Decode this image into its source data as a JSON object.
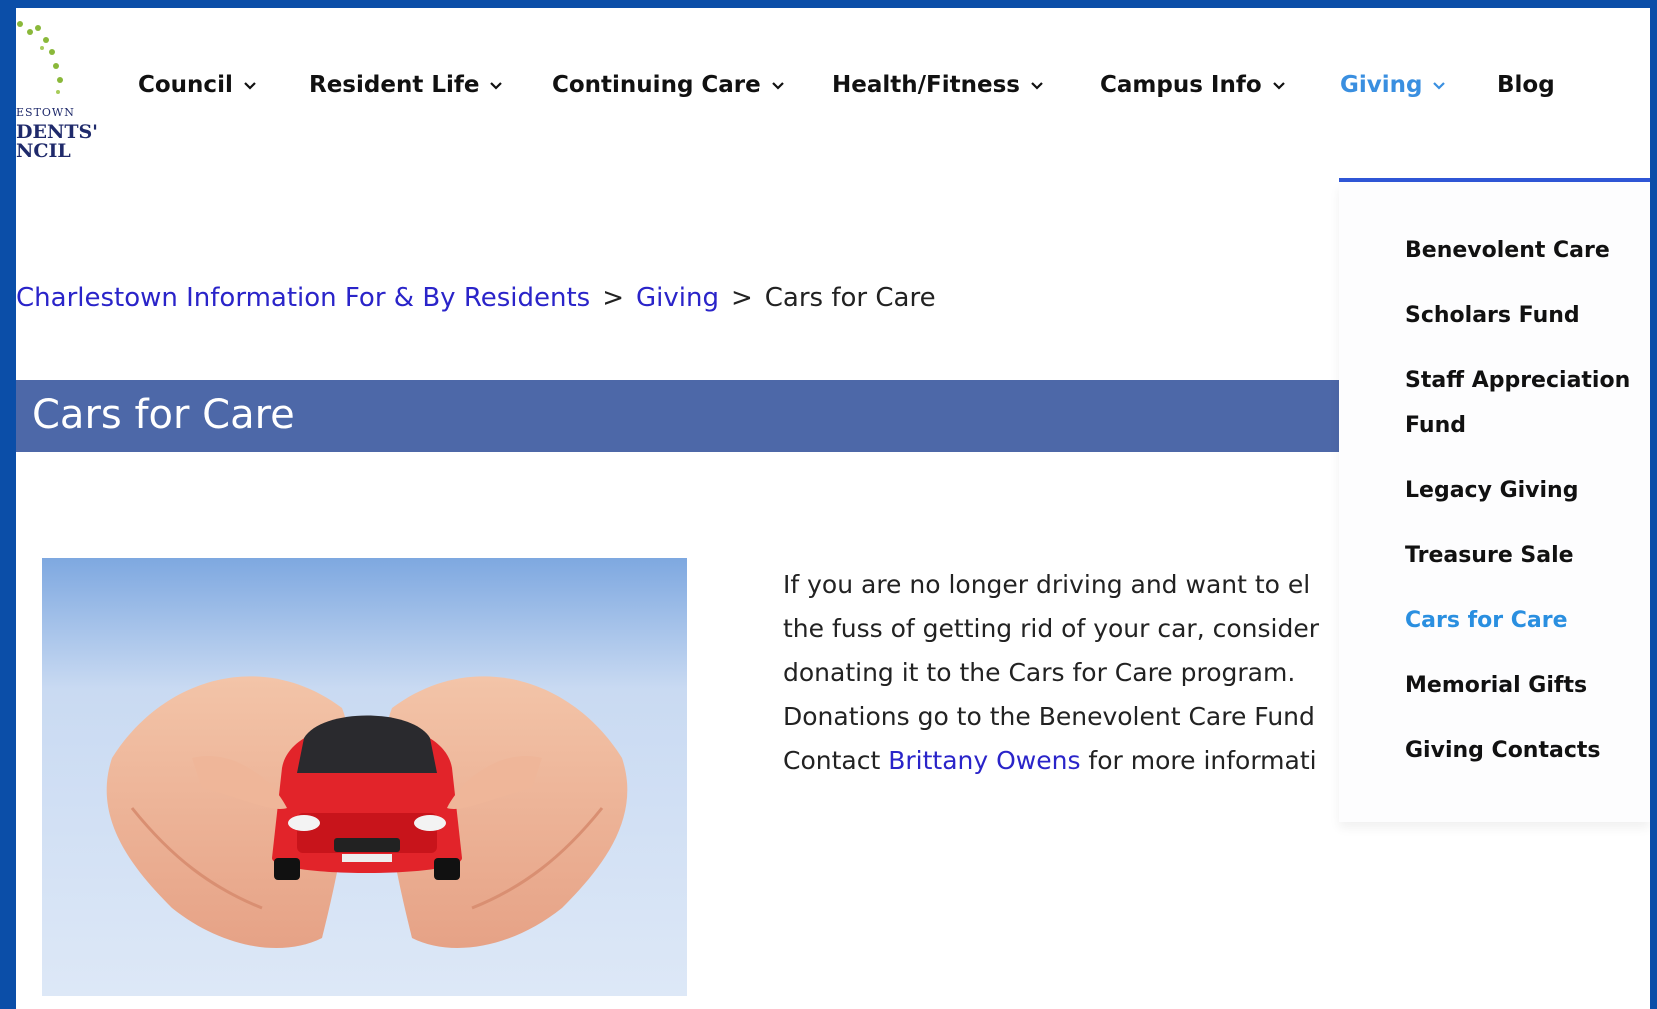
{
  "logo": {
    "line1": "ESTOWN",
    "line2": "DENTS'",
    "line3": "NCIL"
  },
  "nav": {
    "items": [
      {
        "label": "Council"
      },
      {
        "label": "Resident Life"
      },
      {
        "label": "Continuing Care"
      },
      {
        "label": "Health/Fitness"
      },
      {
        "label": "Campus Info"
      },
      {
        "label": "Giving"
      },
      {
        "label": "Blog"
      }
    ],
    "active": "Giving",
    "accent_color": "#3a8fe0"
  },
  "breadcrumb": {
    "home": "Charlestown Information For & By Residents",
    "sep": ">",
    "section": "Giving",
    "current": "Cars for Care"
  },
  "page": {
    "title": "Cars for Care",
    "title_bar_color": "#4d68a8"
  },
  "content": {
    "lines": [
      "If you are no longer driving and want to el",
      "the fuss of getting rid of your car, consider",
      "donating it to the Cars for Care program.",
      "Donations go to the Benevolent Care Fund"
    ],
    "contact_prefix": "Contact ",
    "contact_link": "Brittany Owens",
    "contact_suffix": " for more informati"
  },
  "dropdown": {
    "items": [
      {
        "label": "Benevolent Care"
      },
      {
        "label": "Scholars Fund"
      },
      {
        "label": "Staff Appreciation"
      },
      {
        "label": "Fund"
      },
      {
        "label": "Legacy Giving"
      },
      {
        "label": "Treasure Sale"
      },
      {
        "label": "Cars for Care"
      },
      {
        "label": "Memorial Gifts"
      },
      {
        "label": "Giving Contacts"
      }
    ],
    "active": "Cars for Care"
  }
}
